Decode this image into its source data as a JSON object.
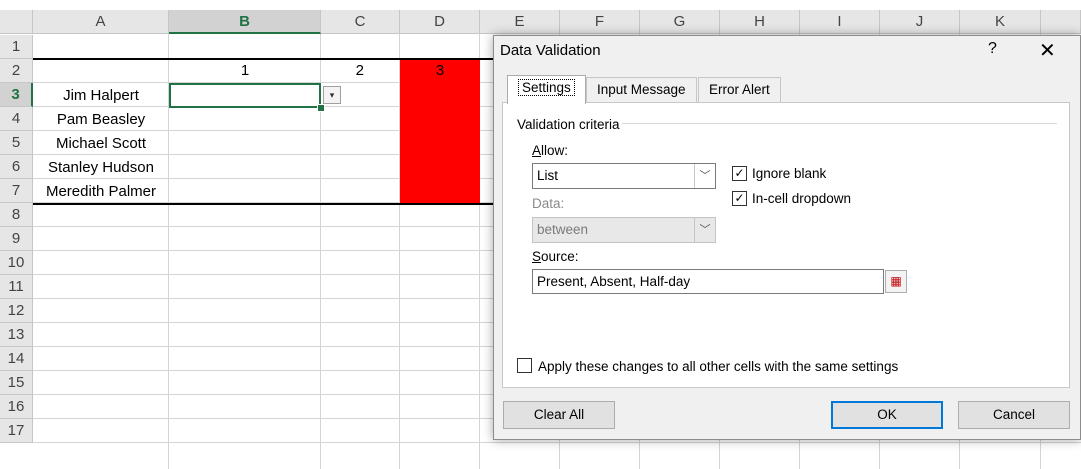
{
  "spreadsheet": {
    "columns": [
      "A",
      "B",
      "C",
      "D",
      "E",
      "F",
      "G",
      "H",
      "I",
      "J",
      "K"
    ],
    "selected_column": "B",
    "rows": [
      "1",
      "2",
      "3",
      "4",
      "5",
      "6",
      "7",
      "8",
      "9",
      "10",
      "11",
      "12",
      "13",
      "14",
      "15",
      "16",
      "17"
    ],
    "selected_row": "3",
    "header_row": [
      "1",
      "2",
      "3"
    ],
    "names": [
      "Jim Halpert",
      "Pam Beasley",
      "Michael Scott",
      "Stanley Hudson",
      "Meredith Palmer"
    ],
    "dropdown_glyph": "▾",
    "accent_color": "#217346",
    "highlight_color": "#ff0000"
  },
  "dialog": {
    "title": "Data Validation",
    "help": "?",
    "close": "✕",
    "tabs": [
      "Settings",
      "Input Message",
      "Error Alert"
    ],
    "section_title": "Validation criteria",
    "allow_label": "Allow:",
    "allow_value": "List",
    "data_label": "Data:",
    "data_value": "between",
    "ignore_blank_label": "Ignore blank",
    "ignore_blank_checked": true,
    "incell_dropdown_label": "In-cell dropdown",
    "incell_dropdown_checked": true,
    "source_label": "Source:",
    "source_value": "Present, Absent, Half-day",
    "apply_all_label": "Apply these changes to all other cells with the same settings",
    "apply_all_checked": false,
    "clear_all_label": "Clear All",
    "ok_label": "OK",
    "cancel_label": "Cancel",
    "check_glyph": "✓",
    "arrow_glyph": "﹀",
    "ref_glyph": "▦"
  }
}
